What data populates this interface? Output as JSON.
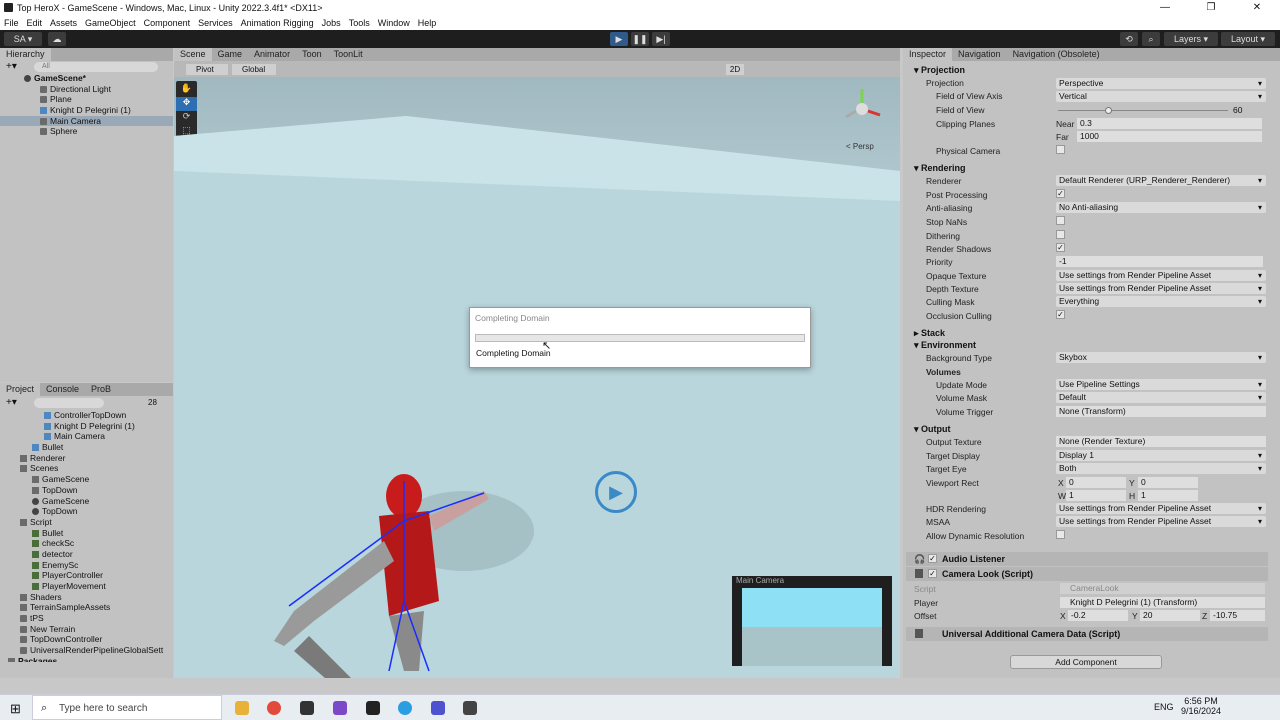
{
  "window": {
    "title": "Top HeroX - GameScene - Windows, Mac, Linux - Unity 2022.3.4f1* <DX11>",
    "min": "—",
    "max": "❐",
    "close": "✕"
  },
  "menu": [
    "File",
    "Edit",
    "Assets",
    "GameObject",
    "Component",
    "Services",
    "Animation Rigging",
    "Jobs",
    "Tools",
    "Window",
    "Help"
  ],
  "toolbar": {
    "account": "SA ▾",
    "layers": "Layers",
    "layout": "Layout"
  },
  "hierarchy": {
    "tab": "Hierarchy",
    "search_placeholder": "All",
    "scene": "GameScene*",
    "items": [
      "Directional Light",
      "Plane",
      "Knight D Pelegrini (1)",
      "Main Camera",
      "Sphere"
    ]
  },
  "scene_tabs": [
    "Scene",
    "Game",
    "Animator",
    "Toon",
    "ToonLit"
  ],
  "scene_toolbar": {
    "pivot": "Pivot",
    "global": "Global",
    "mode2d": "2D",
    "persp": "< Persp"
  },
  "dialog": {
    "title": "Completing Domain",
    "status": "Completing Domain",
    "progress": 0
  },
  "camera_preview": {
    "title": "Main Camera"
  },
  "project": {
    "tabs": [
      "Project",
      "Console",
      "ProB"
    ],
    "count": "28",
    "items": [
      {
        "label": "ControllerTopDown",
        "depth": 3,
        "icon": "prefab"
      },
      {
        "label": "Knight D Pelegrini (1)",
        "depth": 3,
        "icon": "prefab"
      },
      {
        "label": "Main Camera",
        "depth": 3,
        "icon": "prefab"
      },
      {
        "label": "Bullet",
        "depth": 2,
        "icon": "prefab"
      },
      {
        "label": "Renderer",
        "depth": 1,
        "icon": "folder"
      },
      {
        "label": "Scenes",
        "depth": 1,
        "icon": "folder"
      },
      {
        "label": "GameScene",
        "depth": 2,
        "icon": "folder"
      },
      {
        "label": "TopDown",
        "depth": 2,
        "icon": "folder"
      },
      {
        "label": "GameScene",
        "depth": 2,
        "icon": "scene"
      },
      {
        "label": "TopDown",
        "depth": 2,
        "icon": "scene"
      },
      {
        "label": "Script",
        "depth": 1,
        "icon": "folder"
      },
      {
        "label": "Bullet",
        "depth": 2,
        "icon": "cs"
      },
      {
        "label": "checkSc",
        "depth": 2,
        "icon": "cs"
      },
      {
        "label": "detector",
        "depth": 2,
        "icon": "cs"
      },
      {
        "label": "EnemySc",
        "depth": 2,
        "icon": "cs"
      },
      {
        "label": "PlayerController",
        "depth": 2,
        "icon": "cs"
      },
      {
        "label": "PlayerMovement",
        "depth": 2,
        "icon": "cs"
      },
      {
        "label": "Shaders",
        "depth": 1,
        "icon": "folder"
      },
      {
        "label": "TerrainSampleAssets",
        "depth": 1,
        "icon": "folder"
      },
      {
        "label": "tPS",
        "depth": 1,
        "icon": "go"
      },
      {
        "label": "New Terrain",
        "depth": 1,
        "icon": "go"
      },
      {
        "label": "TopDownController",
        "depth": 1,
        "icon": "go"
      },
      {
        "label": "UniversalRenderPipelineGlobalSett",
        "depth": 1,
        "icon": "go"
      },
      {
        "label": "Packages",
        "depth": 0,
        "icon": "folder"
      }
    ]
  },
  "inspector": {
    "tabs": [
      "Inspector",
      "Navigation",
      "Navigation (Obsolete)"
    ],
    "projection": {
      "header": "Projection",
      "projection_label": "Projection",
      "projection": "Perspective",
      "fov_axis_label": "Field of View Axis",
      "fov_axis": "Vertical",
      "fov_label": "Field of View",
      "fov": "60",
      "fov_fraction": 0.3,
      "clip_label": "Clipping Planes",
      "near_label": "Near",
      "near": "0.3",
      "far_label": "Far",
      "far": "1000",
      "physical_label": "Physical Camera"
    },
    "rendering": {
      "header": "Rendering",
      "renderer_label": "Renderer",
      "renderer": "Default Renderer (URP_Renderer_Renderer)",
      "post_label": "Post Processing",
      "aa_label": "Anti-aliasing",
      "aa": "No Anti-aliasing",
      "nan_label": "Stop NaNs",
      "dither_label": "Dithering",
      "shadows_label": "Render Shadows",
      "priority_label": "Priority",
      "priority": "-1",
      "opaque_label": "Opaque Texture",
      "opaque": "Use settings from Render Pipeline Asset",
      "depth_label": "Depth Texture",
      "depth": "Use settings from Render Pipeline Asset",
      "culling_label": "Culling Mask",
      "culling": "Everything",
      "occlusion_label": "Occlusion Culling"
    },
    "stack": {
      "header": "Stack"
    },
    "environment": {
      "header": "Environment",
      "bg_label": "Background Type",
      "bg": "Skybox",
      "volumes_label": "Volumes",
      "update_label": "Update Mode",
      "update": "Use Pipeline Settings",
      "mask_label": "Volume Mask",
      "mask": "Default",
      "trigger_label": "Volume Trigger",
      "trigger": "None (Transform)"
    },
    "output": {
      "header": "Output",
      "tex_label": "Output Texture",
      "tex": "None (Render Texture)",
      "display_label": "Target Display",
      "display": "Display 1",
      "eye_label": "Target Eye",
      "eye": "Both",
      "rect_label": "Viewport Rect",
      "x": "0",
      "y": "0",
      "w": "1",
      "h": "1",
      "hdr_label": "HDR Rendering",
      "hdr": "Use settings from Render Pipeline Asset",
      "msaa_label": "MSAA",
      "msaa": "Use settings from Render Pipeline Asset",
      "dyn_label": "Allow Dynamic Resolution"
    },
    "audio": {
      "title": "Audio Listener"
    },
    "camlook": {
      "title": "Camera Look (Script)",
      "script_label": "Script",
      "script": "CameraLook",
      "player_label": "Player",
      "player": "Knight D Pelegrini (1) (Transform)",
      "offset_label": "Offset",
      "ox": "-0.2",
      "oy": "20",
      "oz": "-10.75"
    },
    "urp": {
      "title": "Universal Additional Camera Data (Script)"
    },
    "add_component": "Add Component",
    "axis_labels": {
      "x": "X",
      "y": "Y",
      "z": "Z",
      "w": "W",
      "h": "H"
    }
  },
  "taskbar": {
    "search_placeholder": "Type here to search",
    "lang": "ENG",
    "time": "6:56 PM",
    "date": "9/16/2024"
  }
}
